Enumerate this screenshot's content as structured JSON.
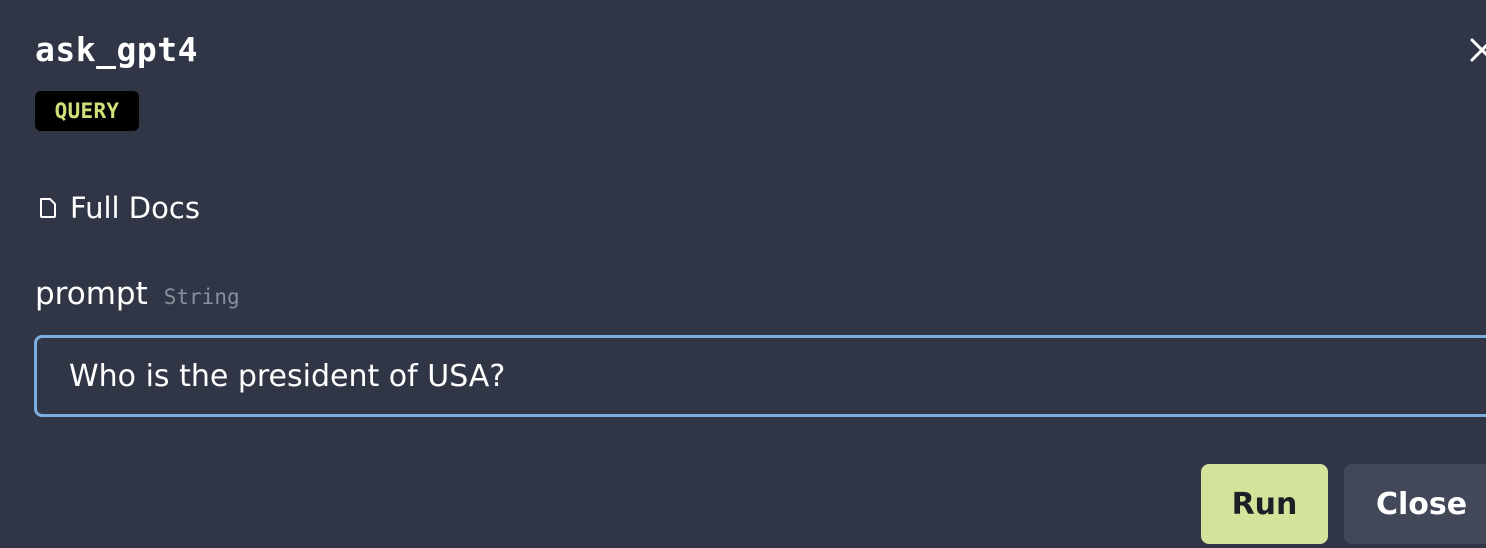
{
  "dialog": {
    "title": "ask_gpt4",
    "badge": "QUERY",
    "docs_link": "Full Docs",
    "close_icon": "close-icon"
  },
  "field": {
    "name": "prompt",
    "type": "String",
    "value": "Who is the president of USA?"
  },
  "actions": {
    "run_label": "Run",
    "close_label": "Close"
  },
  "colors": {
    "background": "#313647",
    "badge_bg": "#000000",
    "badge_text": "#cfe07a",
    "input_border": "#7aaee0",
    "run_button": "#d4e39a",
    "close_button": "#424857"
  }
}
